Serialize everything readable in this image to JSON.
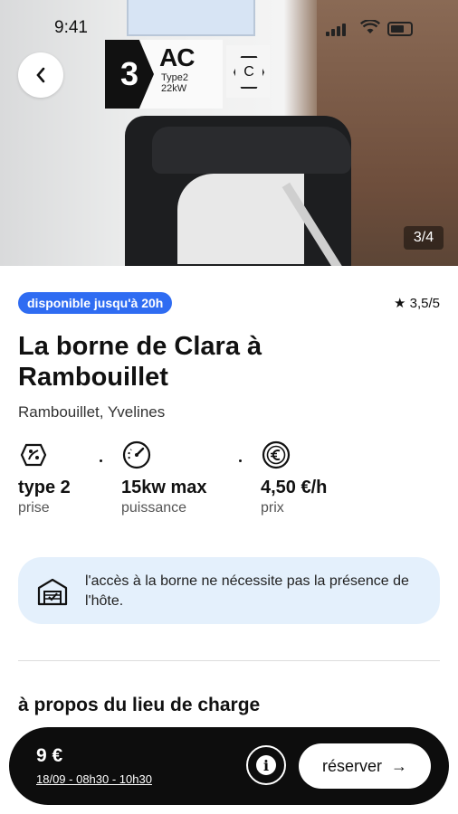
{
  "status_bar": {
    "time": "9:41"
  },
  "hero": {
    "plate_number": "3",
    "plate_type": "AC",
    "plate_sub1": "Type2",
    "plate_sub2": "22kW",
    "plate_hex": "C",
    "photo_counter": "3/4"
  },
  "availability_badge": "disponible jusqu'à 20h",
  "rating": "★ 3,5/5",
  "title": "La borne de Clara à Rambouillet",
  "location": "Rambouillet, Yvelines",
  "specs": [
    {
      "icon": "plug-type-icon",
      "value": "type 2",
      "label": "prise"
    },
    {
      "icon": "gauge-icon",
      "value": "15kw max",
      "label": "puissance"
    },
    {
      "icon": "euro-icon",
      "value": "4,50 €/h",
      "label": "prix"
    }
  ],
  "info_box": {
    "icon": "garage-check-icon",
    "text": "l'accès à la borne ne nécessite pas la présence de l'hôte."
  },
  "section_heading": "à propos du lieu de charge",
  "booking_bar": {
    "price": "9 €",
    "slot": "18/09 - 08h30 - 10h30",
    "reserve_label": "réserver",
    "reserve_arrow": "→",
    "info_glyph": "i"
  },
  "colors": {
    "accent_blue": "#2f6cf2",
    "info_bg": "#e4f0fc",
    "booking_bar_bg": "#0d0d0d"
  }
}
